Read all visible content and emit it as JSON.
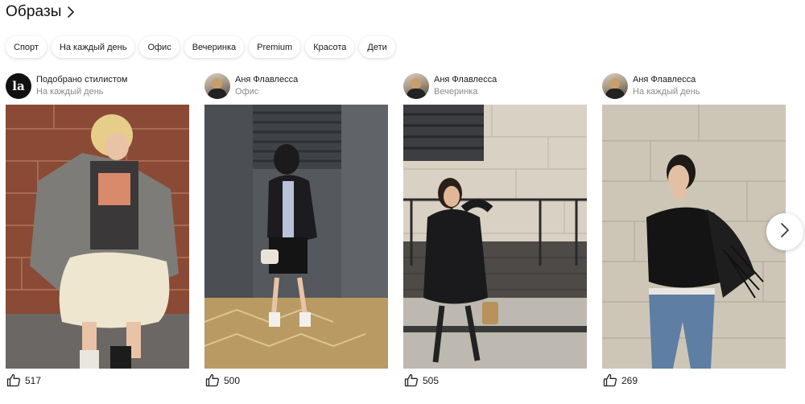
{
  "section": {
    "title": "Образы"
  },
  "chips": [
    "Спорт",
    "На каждый день",
    "Офис",
    "Вечеринка",
    "Premium",
    "Красота",
    "Дети"
  ],
  "cards": [
    {
      "avatar_text": "la",
      "author": "Подобрано стилистом",
      "category": "На каждый день",
      "likes": "517"
    },
    {
      "author": "Аня Флавлесса",
      "category": "Офис",
      "likes": "500"
    },
    {
      "author": "Аня Флавлесса",
      "category": "Вечеринка",
      "likes": "505"
    },
    {
      "author": "Аня Флавлесса",
      "category": "На каждый день",
      "likes": "269"
    }
  ],
  "icons": {
    "section_chevron": "chevron-right-icon",
    "like": "thumbs-up-icon",
    "carousel_next": "chevron-right-icon"
  },
  "colors": {
    "text": "#1a1a1a",
    "secondary_text": "#8a8a8a",
    "background": "#ffffff"
  }
}
